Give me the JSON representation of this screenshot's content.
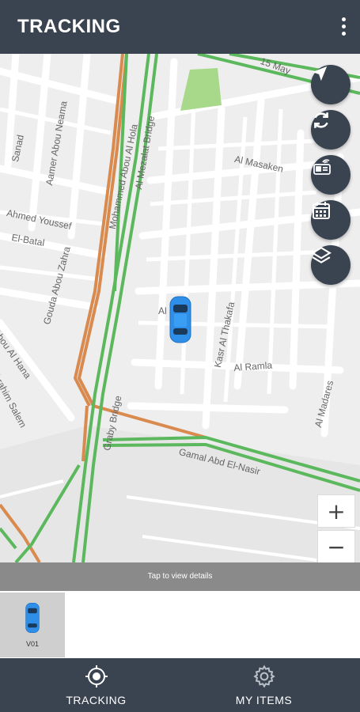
{
  "appbar": {
    "title": "TRACKING",
    "menu_icon": "more-vert-icon"
  },
  "map": {
    "labels": {
      "may15": "15 May",
      "sanad": "Sanad",
      "aamer": "Aamer Abou Neama",
      "mohamed": "Mohammed Abou Al Hola",
      "mezalat": "Al Mezalat Bridge",
      "masaken": "Al Masaken",
      "ahmed": "Ahmed Youssef",
      "elbatal": "El-Batal",
      "gouda": "Gouda Abou Zahra",
      "aljan": "Al Jan",
      "kasr": "Kasr Al Thakafa",
      "ramla": "Al Ramla",
      "abou_hana": "Abou Al Hana",
      "ibrahim": "Ibrahim Salem",
      "madares": "Al Madares",
      "graby": "Graby Bridge",
      "gamal": "Gamal Abd El-Nasir"
    },
    "buttons": {
      "locate": "navigation-arrow-icon",
      "refresh": "refresh-icon",
      "device": "tracker-device-icon",
      "calendar": "calendar-icon",
      "layers": "layers-icon"
    },
    "zoom_in": "+",
    "zoom_out": "−"
  },
  "details_bar": "Tap to view details",
  "vehicles": [
    {
      "name": "V01",
      "icon": "car-icon"
    }
  ],
  "bottom_nav": {
    "tracking": "TRACKING",
    "my_items": "MY ITEMS"
  },
  "colors": {
    "primary": "#3a4350",
    "green_road": "#5cb85c",
    "orange_road": "#d98a4f",
    "car": "#2f8fe8"
  }
}
